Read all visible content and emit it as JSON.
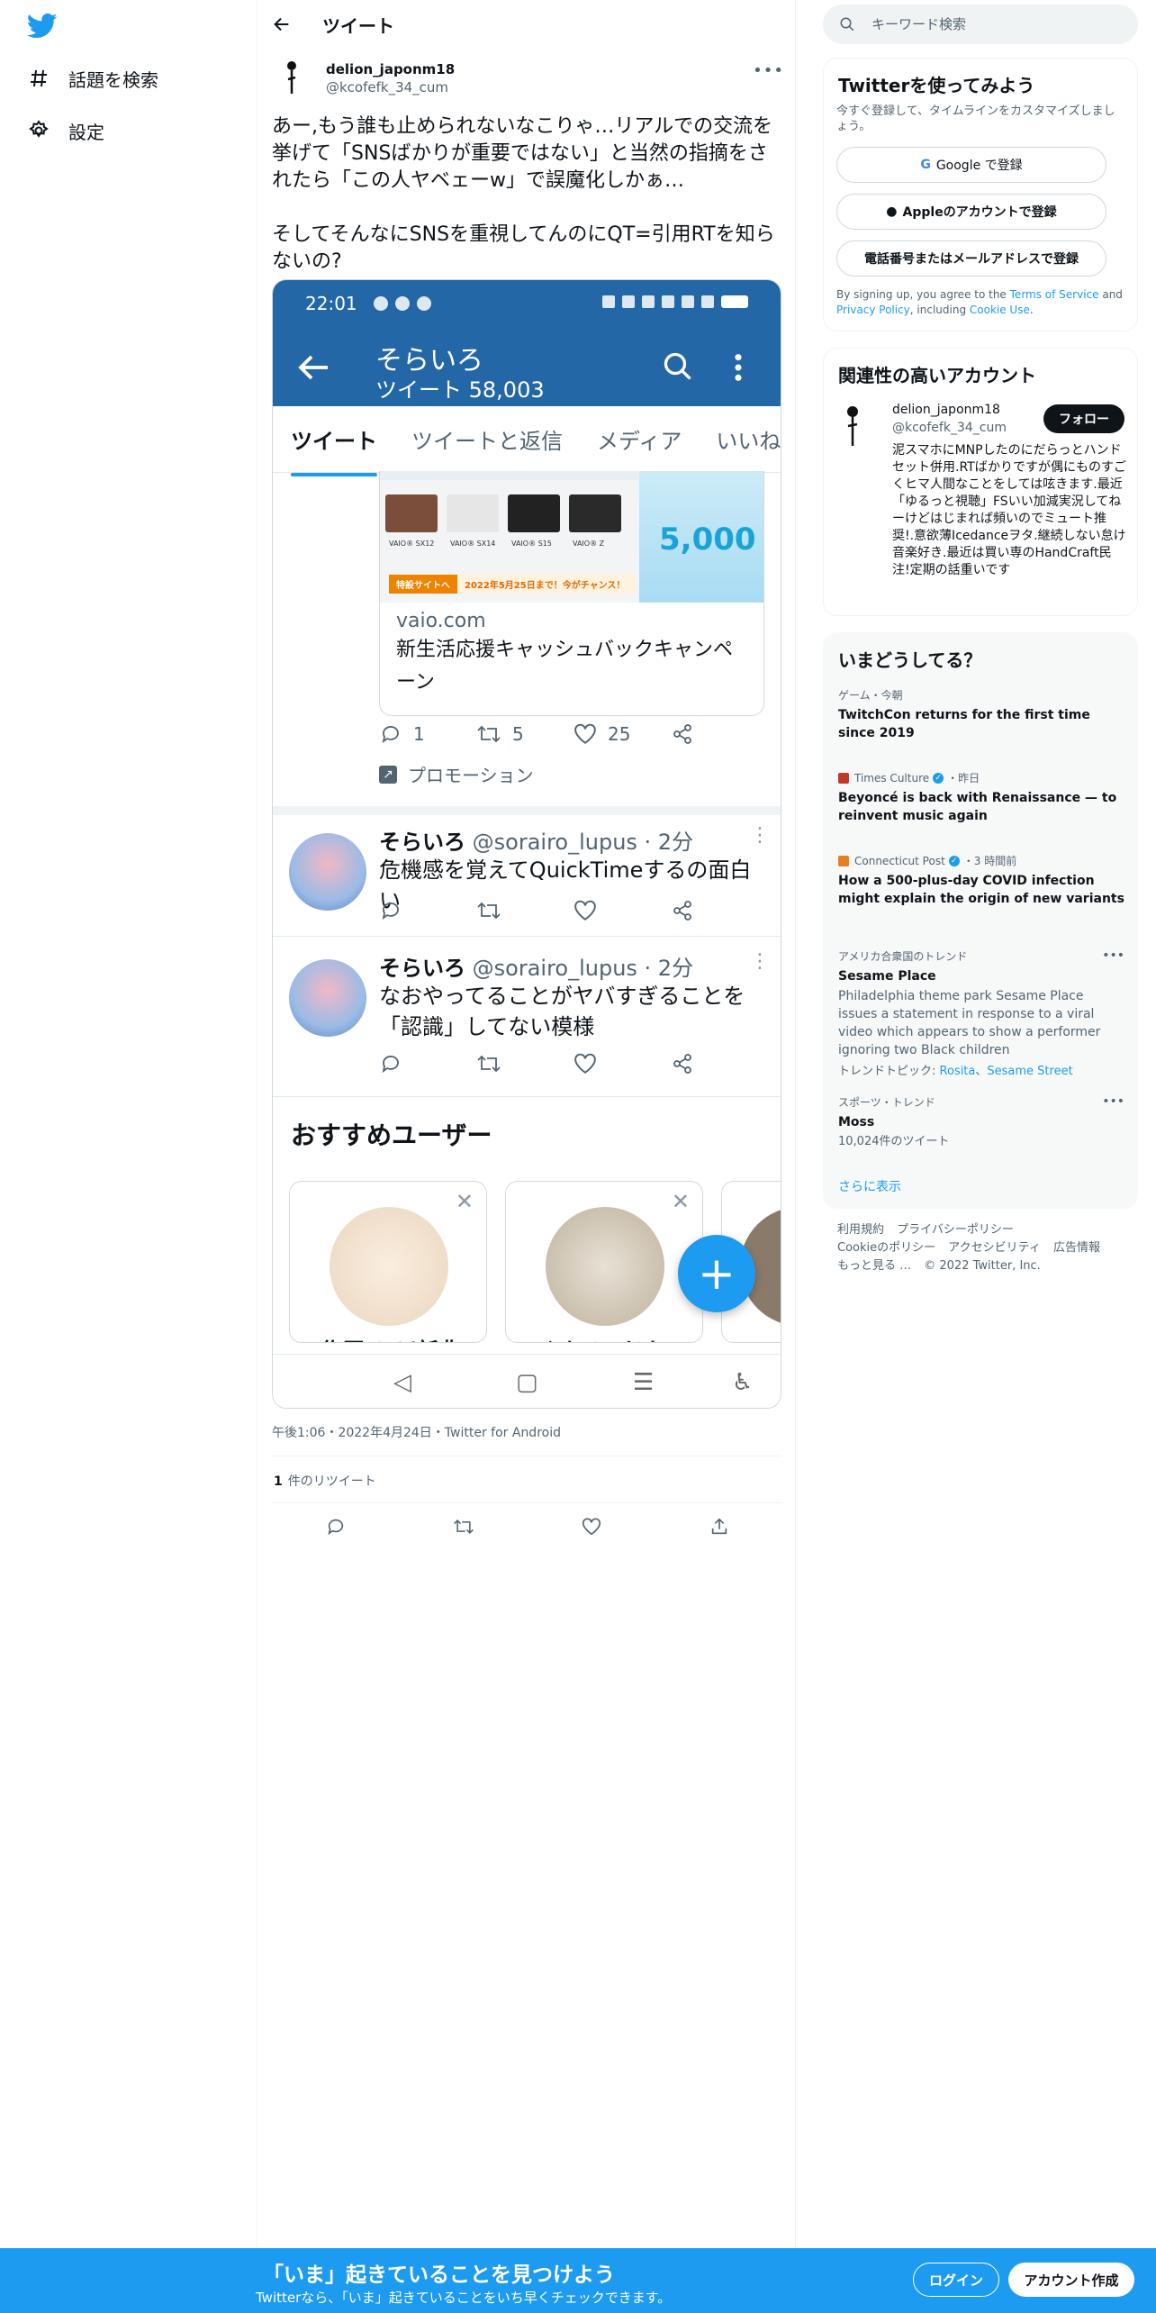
{
  "colors": {
    "brand": "#1d9bf0",
    "phone_bar": "#2367a7",
    "text": "#0f1419",
    "secondary": "#536471"
  },
  "nav": {
    "logo_icon": "twitter-bird-icon",
    "items": [
      {
        "icon": "hashtag-icon",
        "label": "話題を検索"
      },
      {
        "icon": "gear-icon",
        "label": "設定"
      }
    ]
  },
  "header": {
    "back_icon": "back-arrow-icon",
    "title": "ツイート"
  },
  "tweet": {
    "author_name": "delion_japonm18",
    "author_handle": "@kcofefk_34_cum",
    "text": "あー,もう誰も止められないなこりゃ…リアルでの交流を挙げて「SNSばかりが重要ではない」と当然の指摘をされたら「この人ヤベェーw」で誤魔化しかぁ…\n\nそしてそんなにSNSを重視してんのにQT=引用RTを知らないの?",
    "timestamp": "午後1:06・2022年4月24日・Twitter for Android",
    "retweet_count": "1",
    "retweet_label": "件のリツイート"
  },
  "screenshot": {
    "status_time": "22:01",
    "profile_name": "そらいろ",
    "tweet_count": "ツイート 58,003",
    "tabs": [
      "ツイート",
      "ツイートと返信",
      "メディア",
      "いいね"
    ],
    "promo": {
      "domain": "vaio.com",
      "title": "新生活応援キャッシュバックキャンペーン",
      "banner_button": "特設サイトへ",
      "banner_text": "2022年5月25日まで！今がチャンス！",
      "big_text": "5,000",
      "laptops": [
        "VAIO® SX12",
        "VAIO® SX14",
        "VAIO® S15",
        "VAIO® Z"
      ],
      "replies": "1",
      "retweets": "5",
      "likes": "25",
      "label": "プロモーション"
    },
    "tweets": [
      {
        "name": "そらいろ",
        "handle": "@sorairo_lupus · 2分",
        "text": "危機感を覚えてQuickTimeするの面白い"
      },
      {
        "name": "そらいろ",
        "handle": "@sorairo_lupus · 2分",
        "text": "なおやってることがヤバすぎることを「認識」してない模様"
      }
    ],
    "recommended_title": "おすすめユーザー",
    "recommended": [
      {
        "name": "佐原ひろ(新典"
      },
      {
        "name": "くまひつじちゃん"
      }
    ],
    "fab_icon": "+"
  },
  "search": {
    "placeholder": "キーワード検索"
  },
  "signup": {
    "title": "Twitterを使ってみよう",
    "desc": "今すぐ登録して、タイムラインをカスタマイズしましょう。",
    "google": "Google で登録",
    "apple": "Appleのアカウントで登録",
    "phone": "電話番号またはメールアドレスで登録",
    "terms_pre": "By signing up, you agree to the ",
    "terms_link": "Terms of Service",
    "terms_and": " and ",
    "privacy_link": "Privacy Policy",
    "terms_incl": ", including ",
    "cookie_link": "Cookie Use",
    "terms_end": "."
  },
  "related": {
    "title": "関連性の高いアカウント",
    "name": "delion_japonm18",
    "handle": "@kcofefk_34_cum",
    "follow": "フォロー",
    "bio": "泥スマホにMNPしたのにだらっとハンドセット併用.RTばかりですが偶にものすごくヒマ人間なことをしては呟きます.最近「ゆるっと視聴」FSいい加減実況してねーけどはじまれば頻いのでミュート推奨!.意欲薄Icedanceヲタ.継続しない怠け音楽好き.最近は買い専のHandCraft民 注!定期の話重いです"
  },
  "trends": {
    "title": "いまどうしてる？",
    "items": [
      {
        "meta": "ゲーム・今朝",
        "title": "TwitchCon returns for the first time since 2019"
      },
      {
        "source": "Times Culture",
        "when": "・昨日",
        "title": "Beyoncé is back with Renaissance — to reinvent music again"
      },
      {
        "source": "Connecticut Post",
        "when": "・3 時間前",
        "title": "How a 500-plus-day COVID infection might explain the origin of new variants"
      },
      {
        "meta": "アメリカ合衆国のトレンド",
        "title": "Sesame Place",
        "desc": "Philadelphia theme park Sesame Place issues a statement in response to a viral video which appears to show a performer ignoring two Black children",
        "topics_label": "トレンドトピック: ",
        "topic1": "Rosita",
        "topic2": "Sesame Street"
      },
      {
        "meta": "スポーツ・トレンド",
        "title": "Moss",
        "desc": "10,024件のツイート"
      }
    ],
    "show_more": "さらに表示"
  },
  "footer": {
    "links": [
      "利用規約",
      "プライバシーポリシー",
      "Cookieのポリシー",
      "アクセシビリティ",
      "広告情報",
      "もっと見る …",
      "© 2022 Twitter, Inc."
    ]
  },
  "banner": {
    "title": "「いま」起きていることを見つけよう",
    "subtitle": "Twitterなら、「いま」起きていることをいち早くチェックできます。",
    "login": "ログイン",
    "signup": "アカウント作成"
  }
}
